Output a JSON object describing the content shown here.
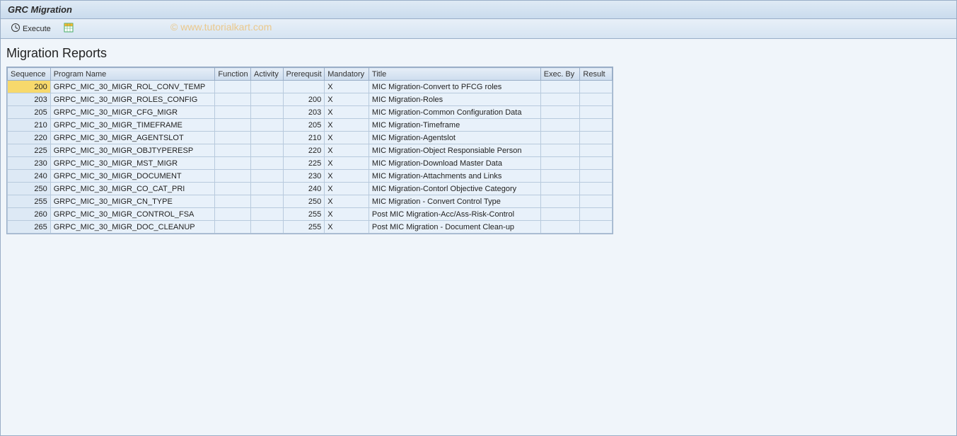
{
  "window": {
    "title": "GRC Migration"
  },
  "toolbar": {
    "execute_label": "Execute"
  },
  "watermark": "© www.tutorialkart.com",
  "section": {
    "title": "Migration Reports"
  },
  "table": {
    "headers": {
      "sequence": "Sequence",
      "program_name": "Program Name",
      "function": "Function",
      "activity": "Activity",
      "prerequisit": "Prerequsit",
      "mandatory": "Mandatory",
      "title": "Title",
      "exec_by": "Exec. By",
      "result": "Result"
    },
    "rows": [
      {
        "sequence": "200",
        "program_name": "GRPC_MIC_30_MIGR_ROL_CONV_TEMP",
        "function": "",
        "activity": "",
        "prerequisit": "",
        "mandatory": "X",
        "title": "MIC Migration-Convert to PFCG roles",
        "exec_by": "",
        "result": ""
      },
      {
        "sequence": "203",
        "program_name": "GRPC_MIC_30_MIGR_ROLES_CONFIG",
        "function": "",
        "activity": "",
        "prerequisit": "200",
        "mandatory": "X",
        "title": "MIC Migration-Roles",
        "exec_by": "",
        "result": ""
      },
      {
        "sequence": "205",
        "program_name": "GRPC_MIC_30_MIGR_CFG_MIGR",
        "function": "",
        "activity": "",
        "prerequisit": "203",
        "mandatory": "X",
        "title": "MIC Migration-Common Configuration Data",
        "exec_by": "",
        "result": ""
      },
      {
        "sequence": "210",
        "program_name": "GRPC_MIC_30_MIGR_TIMEFRAME",
        "function": "",
        "activity": "",
        "prerequisit": "205",
        "mandatory": "X",
        "title": "MIC Migration-Timeframe",
        "exec_by": "",
        "result": ""
      },
      {
        "sequence": "220",
        "program_name": "GRPC_MIC_30_MIGR_AGENTSLOT",
        "function": "",
        "activity": "",
        "prerequisit": "210",
        "mandatory": "X",
        "title": "MIC Migration-Agentslot",
        "exec_by": "",
        "result": ""
      },
      {
        "sequence": "225",
        "program_name": "GRPC_MIC_30_MIGR_OBJTYPERESP",
        "function": "",
        "activity": "",
        "prerequisit": "220",
        "mandatory": "X",
        "title": "MIC Migration-Object Responsiable Person",
        "exec_by": "",
        "result": ""
      },
      {
        "sequence": "230",
        "program_name": "GRPC_MIC_30_MIGR_MST_MIGR",
        "function": "",
        "activity": "",
        "prerequisit": "225",
        "mandatory": "X",
        "title": "MIC Migration-Download Master Data",
        "exec_by": "",
        "result": ""
      },
      {
        "sequence": "240",
        "program_name": "GRPC_MIC_30_MIGR_DOCUMENT",
        "function": "",
        "activity": "",
        "prerequisit": "230",
        "mandatory": "X",
        "title": "MIC Migration-Attachments and Links",
        "exec_by": "",
        "result": ""
      },
      {
        "sequence": "250",
        "program_name": "GRPC_MIC_30_MIGR_CO_CAT_PRI",
        "function": "",
        "activity": "",
        "prerequisit": "240",
        "mandatory": "X",
        "title": "MIC Migration-Contorl Objective Category",
        "exec_by": "",
        "result": ""
      },
      {
        "sequence": "255",
        "program_name": "GRPC_MIC_30_MIGR_CN_TYPE",
        "function": "",
        "activity": "",
        "prerequisit": "250",
        "mandatory": "X",
        "title": "MIC Migration - Convert Control Type",
        "exec_by": "",
        "result": ""
      },
      {
        "sequence": "260",
        "program_name": "GRPC_MIC_30_MIGR_CONTROL_FSA",
        "function": "",
        "activity": "",
        "prerequisit": "255",
        "mandatory": "X",
        "title": "Post MIC Migration-Acc/Ass-Risk-Control",
        "exec_by": "",
        "result": ""
      },
      {
        "sequence": "265",
        "program_name": "GRPC_MIC_30_MIGR_DOC_CLEANUP",
        "function": "",
        "activity": "",
        "prerequisit": "255",
        "mandatory": "X",
        "title": "Post MIC Migration - Document Clean-up",
        "exec_by": "",
        "result": ""
      }
    ]
  }
}
